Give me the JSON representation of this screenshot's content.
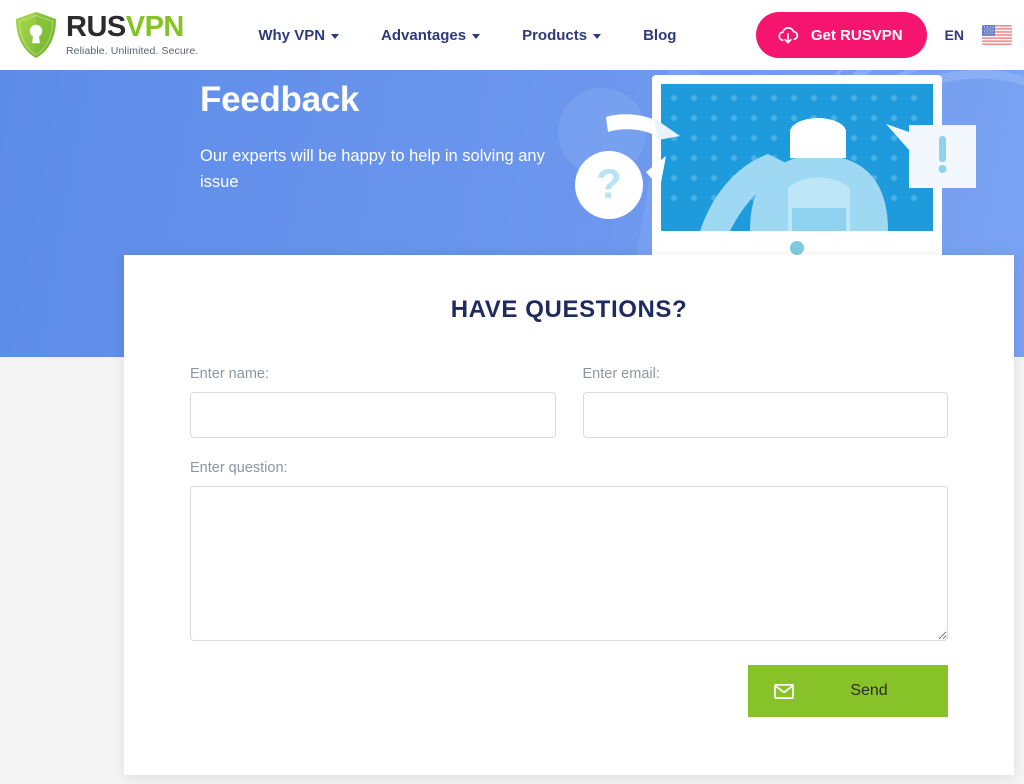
{
  "header": {
    "logo": {
      "icon": "shield-keyhole-icon",
      "name_primary": "RUS",
      "name_secondary": "VPN",
      "tagline": "Reliable. Unlimited. Secure."
    },
    "nav": [
      {
        "label": "Why VPN",
        "has_dropdown": true
      },
      {
        "label": "Advantages",
        "has_dropdown": true
      },
      {
        "label": "Products",
        "has_dropdown": true
      },
      {
        "label": "Blog",
        "has_dropdown": false
      }
    ],
    "cta": {
      "label": "Get RUSVPN",
      "icon": "cloud-download-icon",
      "color": "#f5146e"
    },
    "language": {
      "code": "EN",
      "flag": "us-flag-icon"
    }
  },
  "hero": {
    "title": "Feedback",
    "subtitle": "Our experts will be happy to help in solving any issue",
    "background_color": "#6c96ee",
    "illustration": "support-agent-monitor-illustration",
    "bubbles": [
      {
        "name": "question-bubble",
        "glyph": "?"
      },
      {
        "name": "exclamation-bubble",
        "glyph": "!"
      }
    ]
  },
  "form": {
    "title": "HAVE QUESTIONS?",
    "fields": {
      "name": {
        "label": "Enter name:",
        "value": "",
        "placeholder": ""
      },
      "email": {
        "label": "Enter email:",
        "value": "",
        "placeholder": ""
      },
      "question": {
        "label": "Enter question:",
        "value": "",
        "placeholder": ""
      }
    },
    "submit": {
      "label": "Send",
      "icon": "envelope-icon",
      "color": "#87c328"
    }
  }
}
